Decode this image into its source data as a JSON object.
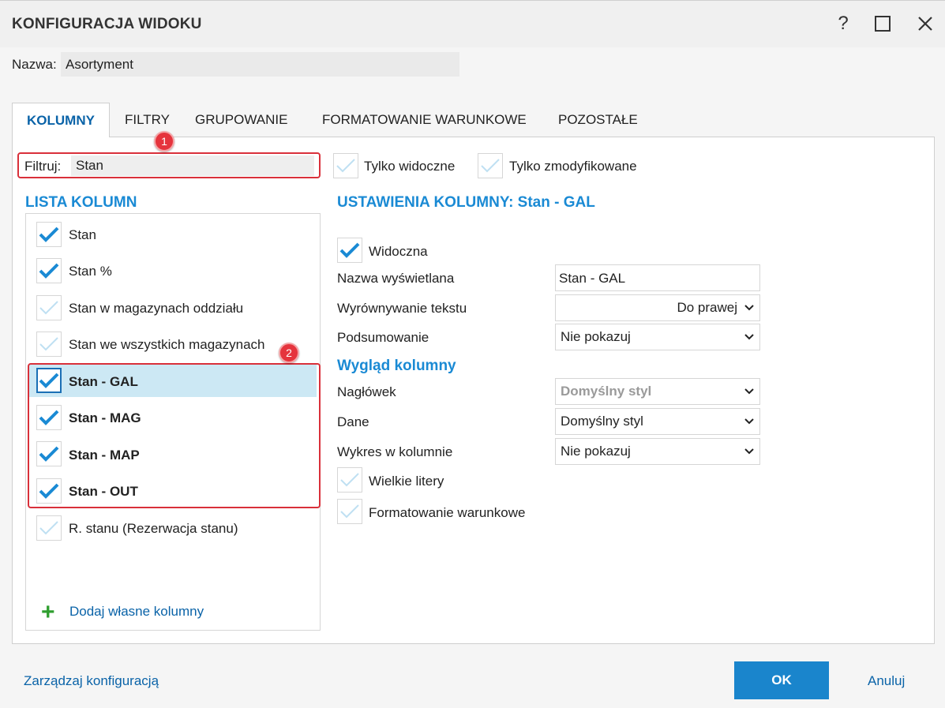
{
  "dialog": {
    "title": "KONFIGURACJA WIDOKU",
    "help_icon": "?",
    "name_label": "Nazwa:",
    "name_value": "Asortyment"
  },
  "tabs": [
    {
      "label": "KOLUMNY",
      "active": true
    },
    {
      "label": "FILTRY"
    },
    {
      "label": "GRUPOWANIE"
    },
    {
      "label": "FORMATOWANIE WARUNKOWE"
    },
    {
      "label": "POZOSTAŁE"
    }
  ],
  "filter": {
    "label": "Filtruj:",
    "value": "Stan",
    "only_visible": "Tylko widoczne",
    "only_modified": "Tylko zmodyfikowane"
  },
  "badges": [
    "1",
    "2"
  ],
  "column_list": {
    "title": "LISTA KOLUMN",
    "items": [
      {
        "label": "Stan",
        "checked": true
      },
      {
        "label": "Stan %",
        "checked": true
      },
      {
        "label": "Stan w magazynach oddziału",
        "checked": false
      },
      {
        "label": "Stan we wszystkich magazynach",
        "checked": false
      },
      {
        "label": "Stan - GAL",
        "checked": true
      },
      {
        "label": "Stan - MAG",
        "checked": true
      },
      {
        "label": "Stan - MAP",
        "checked": true
      },
      {
        "label": "Stan - OUT",
        "checked": true
      },
      {
        "label": "R. stanu (Rezerwacja stanu)",
        "checked": false
      }
    ],
    "add_label": "Dodaj własne kolumny"
  },
  "settings": {
    "title": "USTAWIENIA KOLUMNY: Stan - GAL",
    "visible_label": "Widoczna",
    "display_name_label": "Nazwa wyświetlana",
    "display_name_value": "Stan - GAL",
    "align_label": "Wyrównywanie tekstu",
    "align_value": "Do prawej",
    "summary_label": "Podsumowanie",
    "summary_value": "Nie pokazuj",
    "appearance_title": "Wygląd kolumny",
    "header_label": "Nagłówek",
    "header_value": "Domyślny styl",
    "data_label": "Dane",
    "data_value": "Domyślny styl",
    "chart_label": "Wykres w kolumnie",
    "chart_value": "Nie pokazuj",
    "uppercase_label": "Wielkie litery",
    "conditional_label": "Formatowanie warunkowe"
  },
  "footer": {
    "manage_label": "Zarządzaj konfiguracją",
    "ok_label": "OK",
    "cancel_label": "Anuluj"
  },
  "colors": {
    "accent": "#1a8ad4",
    "link": "#0a63a8",
    "highlight": "#d9303a",
    "selected_row": "#cce8f4"
  }
}
